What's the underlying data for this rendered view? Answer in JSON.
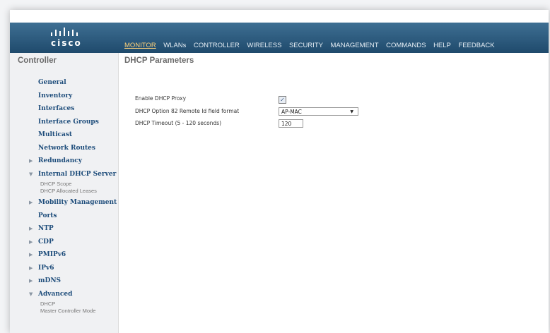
{
  "brand": {
    "logo_text": "cisco"
  },
  "menu": [
    "MONITOR",
    "WLANs",
    "CONTROLLER",
    "WIRELESS",
    "SECURITY",
    "MANAGEMENT",
    "COMMANDS",
    "HELP",
    "FEEDBACK"
  ],
  "sidebar": {
    "title": "Controller",
    "items": {
      "general": "General",
      "inventory": "Inventory",
      "interfaces": "Interfaces",
      "interface_groups": "Interface Groups",
      "multicast": "Multicast",
      "network_routes": "Network Routes",
      "redundancy": "Redundancy",
      "internal_dhcp_server": "Internal DHCP Server",
      "dhcp_scope": "DHCP Scope",
      "dhcp_allocated_leases": "DHCP Allocated Leases",
      "mobility_management": "Mobility Management",
      "ports": "Ports",
      "ntp": "NTP",
      "cdp": "CDP",
      "pmipv6": "PMIPv6",
      "ipv6": "IPv6",
      "mdns": "mDNS",
      "advanced": "Advanced",
      "adv_dhcp": "DHCP",
      "adv_master": "Master Controller Mode"
    },
    "arrow_collapsed": "▶",
    "arrow_expanded": "▼"
  },
  "page": {
    "title": "DHCP Parameters",
    "proxy_label": "Enable DHCP Proxy",
    "proxy_checked": true,
    "proxy_mark": "✓",
    "option82_label": "DHCP Option 82 Remote Id field format",
    "option82_value": "AP-MAC",
    "timeout_label": "DHCP Timeout (5 - 120 seconds)",
    "timeout_value": "120"
  },
  "colors": {
    "accent": "#ffd27a",
    "link": "#1e4d7b",
    "header_top": "#3e6f93",
    "header_bottom": "#1f4a6c"
  }
}
